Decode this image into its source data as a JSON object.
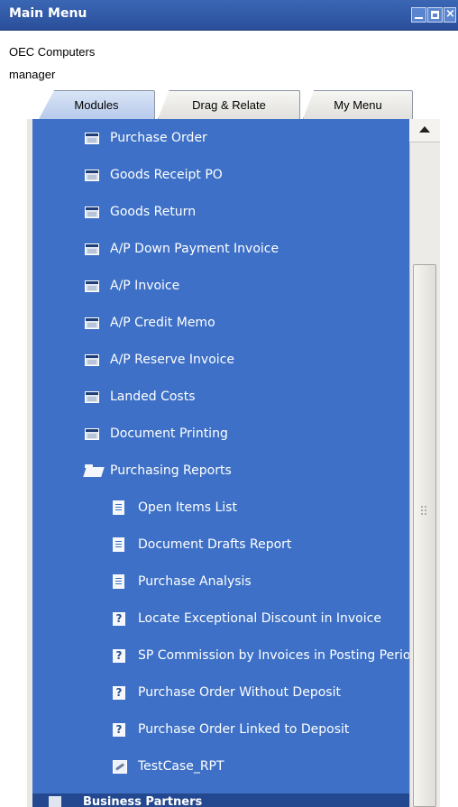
{
  "window": {
    "title": "Main Menu"
  },
  "session": {
    "company": "OEC Computers",
    "user": "manager"
  },
  "tabs": [
    {
      "label": "Modules",
      "active": true
    },
    {
      "label": "Drag & Relate",
      "active": false
    },
    {
      "label": "My Menu",
      "active": false
    }
  ],
  "menu": [
    {
      "label": "Purchase Order",
      "icon": "form-icon"
    },
    {
      "label": "Goods Receipt PO",
      "icon": "form-icon"
    },
    {
      "label": "Goods Return",
      "icon": "form-icon"
    },
    {
      "label": "A/P Down Payment Invoice",
      "icon": "form-icon"
    },
    {
      "label": "A/P Invoice",
      "icon": "form-icon"
    },
    {
      "label": "A/P Credit Memo",
      "icon": "form-icon"
    },
    {
      "label": "A/P Reserve Invoice",
      "icon": "form-icon"
    },
    {
      "label": "Landed Costs",
      "icon": "form-icon"
    },
    {
      "label": "Document Printing",
      "icon": "form-icon"
    },
    {
      "label": "Purchasing Reports",
      "icon": "open-folder-icon"
    },
    {
      "label": "Open Items List",
      "icon": "report-doc-icon"
    },
    {
      "label": "Document Drafts Report",
      "icon": "report-doc-icon"
    },
    {
      "label": "Purchase Analysis",
      "icon": "report-doc-icon"
    },
    {
      "label": "Locate Exceptional Discount in Invoice",
      "icon": "query-icon"
    },
    {
      "label": "SP Commission by Invoices in Posting Period",
      "icon": "query-icon"
    },
    {
      "label": "Purchase Order Without Deposit",
      "icon": "query-icon"
    },
    {
      "label": "Purchase Order Linked to Deposit",
      "icon": "query-icon"
    },
    {
      "label": "TestCase_RPT",
      "icon": "crystal-report-icon"
    }
  ],
  "bottom": {
    "label": "Business Partners"
  },
  "colors": {
    "panel": "#3d70c6",
    "titlebar": "#2a4f9a"
  }
}
